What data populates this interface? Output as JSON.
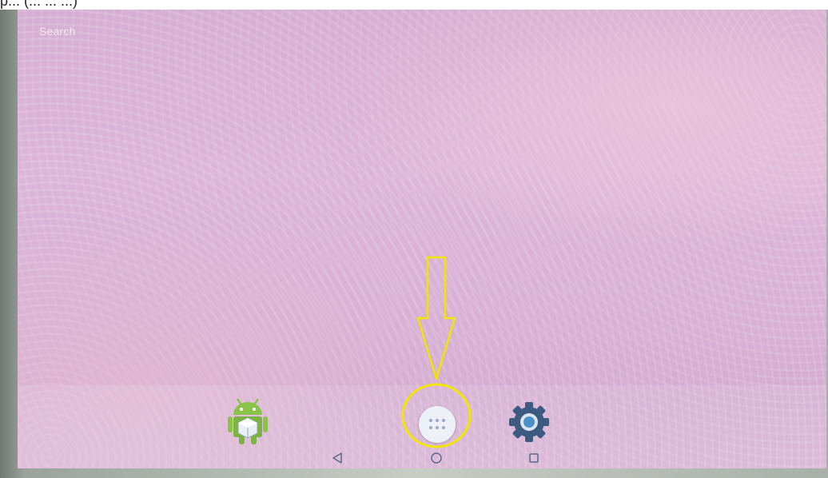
{
  "caption": {
    "text": "p... (... ... ...)"
  },
  "home_screen": {
    "search_label": "Search",
    "wallpaper_color": "#d8b1d6"
  },
  "dock": {
    "apps": [
      {
        "name": "Android app",
        "icon": "android-robot-icon"
      },
      {
        "name": "All apps",
        "icon": "app-drawer-dots-icon"
      },
      {
        "name": "Settings",
        "icon": "gear-icon"
      }
    ]
  },
  "nav_bar": {
    "buttons": [
      {
        "name": "back",
        "icon": "back-triangle-icon"
      },
      {
        "name": "home",
        "icon": "home-circle-icon"
      },
      {
        "name": "recents",
        "icon": "recents-square-icon"
      }
    ]
  },
  "annotation": {
    "color": "#f2e600",
    "shape": "arrow-down-and-circle"
  }
}
